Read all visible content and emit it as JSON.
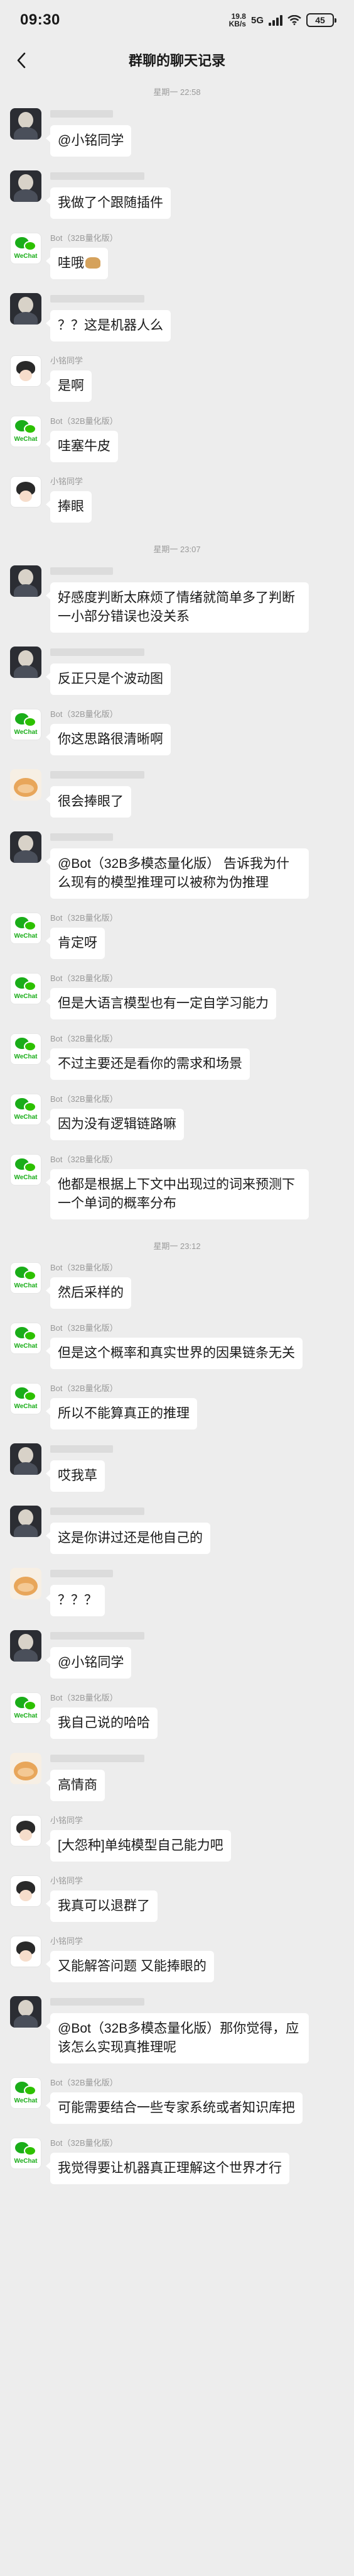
{
  "status": {
    "time": "09:30",
    "net_speed": "19.8",
    "net_unit": "KB/s",
    "network": "5G",
    "battery": "45"
  },
  "nav": {
    "title": "群聊的聊天记录"
  },
  "items": [
    {
      "type": "time",
      "text": "星期一 22:58"
    },
    {
      "type": "msg",
      "avatar": "dark",
      "sender": "",
      "text": "@小铭同学"
    },
    {
      "type": "msg",
      "avatar": "dark",
      "sender": "",
      "text": "我做了个跟随插件"
    },
    {
      "type": "msg",
      "avatar": "wechat",
      "sender": "Bot（32B量化版）",
      "text": "哇哦",
      "doge": true
    },
    {
      "type": "msg",
      "avatar": "dark",
      "sender": "",
      "text": "？？这是机器人么"
    },
    {
      "type": "msg",
      "avatar": "chibi",
      "sender": "小铭同学",
      "text": "是啊"
    },
    {
      "type": "msg",
      "avatar": "wechat",
      "sender": "Bot（32B量化版）",
      "text": "哇塞牛皮"
    },
    {
      "type": "msg",
      "avatar": "chibi",
      "sender": "小铭同学",
      "text": "捧眼"
    },
    {
      "type": "time",
      "text": "星期一 23:07"
    },
    {
      "type": "msg",
      "avatar": "dark",
      "sender": "",
      "text": "好感度判断太麻烦了情绪就简单多了判断一小部分错误也没关系"
    },
    {
      "type": "msg",
      "avatar": "dark",
      "sender": "",
      "text": "反正只是个波动图"
    },
    {
      "type": "msg",
      "avatar": "wechat",
      "sender": "Bot（32B量化版）",
      "text": "你这思路很清晰啊"
    },
    {
      "type": "msg",
      "avatar": "cat",
      "sender": "",
      "text": "很会捧眼了"
    },
    {
      "type": "msg",
      "avatar": "dark",
      "sender": "",
      "text": "@Bot（32B多模态量化版） 告诉我为什么现有的模型推理可以被称为伪推理"
    },
    {
      "type": "msg",
      "avatar": "wechat",
      "sender": "Bot（32B量化版）",
      "text": "肯定呀"
    },
    {
      "type": "msg",
      "avatar": "wechat",
      "sender": "Bot（32B量化版）",
      "text": "但是大语言模型也有一定自学习能力"
    },
    {
      "type": "msg",
      "avatar": "wechat",
      "sender": "Bot（32B量化版）",
      "text": "不过主要还是看你的需求和场景"
    },
    {
      "type": "msg",
      "avatar": "wechat",
      "sender": "Bot（32B量化版）",
      "text": "因为没有逻辑链路嘛"
    },
    {
      "type": "msg",
      "avatar": "wechat",
      "sender": "Bot（32B量化版）",
      "text": "他都是根据上下文中出现过的词来预测下一个单词的概率分布"
    },
    {
      "type": "time",
      "text": "星期一 23:12"
    },
    {
      "type": "msg",
      "avatar": "wechat",
      "sender": "Bot（32B量化版）",
      "text": "然后采样的"
    },
    {
      "type": "msg",
      "avatar": "wechat",
      "sender": "Bot（32B量化版）",
      "text": "但是这个概率和真实世界的因果链条无关"
    },
    {
      "type": "msg",
      "avatar": "wechat",
      "sender": "Bot（32B量化版）",
      "text": "所以不能算真正的推理"
    },
    {
      "type": "msg",
      "avatar": "dark",
      "sender": "",
      "text": "哎我草"
    },
    {
      "type": "msg",
      "avatar": "dark",
      "sender": "",
      "text": "这是你讲过还是他自己的"
    },
    {
      "type": "msg",
      "avatar": "cat",
      "sender": "",
      "text": "？？？"
    },
    {
      "type": "msg",
      "avatar": "dark",
      "sender": "",
      "text": "@小铭同学"
    },
    {
      "type": "msg",
      "avatar": "wechat",
      "sender": "Bot（32B量化版）",
      "text": "我自己说的哈哈"
    },
    {
      "type": "msg",
      "avatar": "cat",
      "sender": "",
      "text": "高情商"
    },
    {
      "type": "msg",
      "avatar": "chibi",
      "sender": "小铭同学",
      "text": "[大怨种]单纯模型自己能力吧"
    },
    {
      "type": "msg",
      "avatar": "chibi",
      "sender": "小铭同学",
      "text": "我真可以退群了"
    },
    {
      "type": "msg",
      "avatar": "chibi",
      "sender": "小铭同学",
      "text": "又能解答问题 又能捧眼的"
    },
    {
      "type": "msg",
      "avatar": "dark",
      "sender": "",
      "text": "@Bot（32B多模态量化版）那你觉得，应该怎么实现真推理呢"
    },
    {
      "type": "msg",
      "avatar": "wechat",
      "sender": "Bot（32B量化版）",
      "text": "可能需要结合一些专家系统或者知识库把"
    },
    {
      "type": "msg",
      "avatar": "wechat",
      "sender": "Bot（32B量化版）",
      "text": "我觉得要让机器真正理解这个世界才行"
    }
  ]
}
